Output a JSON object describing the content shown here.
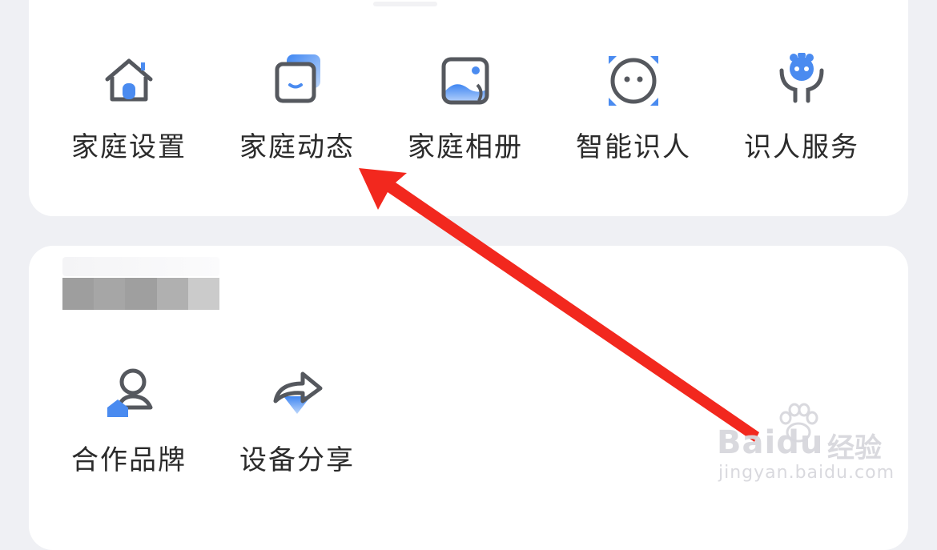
{
  "family_section": {
    "items": [
      {
        "label": "家庭设置",
        "icon": "home-settings-icon"
      },
      {
        "label": "家庭动态",
        "icon": "family-feed-icon"
      },
      {
        "label": "家庭相册",
        "icon": "photo-album-icon"
      },
      {
        "label": "智能识人",
        "icon": "face-recognition-icon"
      },
      {
        "label": "识人服务",
        "icon": "recognition-service-icon"
      }
    ]
  },
  "other_section": {
    "items": [
      {
        "label": "合作品牌",
        "icon": "partner-brand-icon"
      },
      {
        "label": "设备分享",
        "icon": "device-share-icon"
      }
    ]
  },
  "watermark": {
    "brand": "Baidu",
    "brand_cn": "经验",
    "url": "jingyan.baidu.com"
  },
  "colors": {
    "accent_blue": "#4a8bf0",
    "icon_gray": "#55585e",
    "annotation_red": "#f2281e",
    "page_bg": "#eff0f4"
  }
}
